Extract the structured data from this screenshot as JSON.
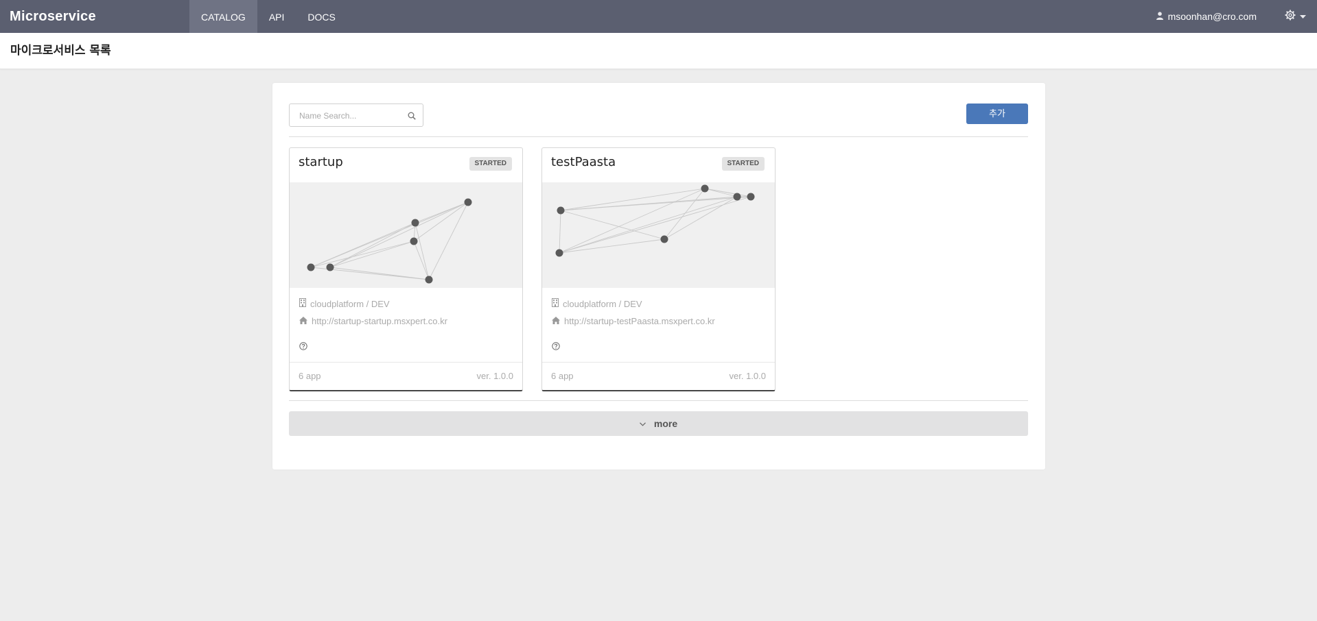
{
  "topbar": {
    "brand": "Microservice",
    "nav": [
      "CATALOG",
      "API",
      "DOCS"
    ],
    "active_nav": "CATALOG",
    "user": "msoonhan@cro.com",
    "user_icon": "user-icon",
    "settings_icon": "gear-icon"
  },
  "page": {
    "title": "마이크로서비스 목록"
  },
  "toolbar": {
    "search_placeholder": "Name Search...",
    "add_label": "추가"
  },
  "services": [
    {
      "name": "startup",
      "status": "STARTED",
      "org": "cloudplatform / DEV",
      "url": "http://startup-startup.msxpert.co.kr",
      "apps": "6 app",
      "version": "ver. 1.0.0"
    },
    {
      "name": "testPaasta",
      "status": "STARTED",
      "org": "cloudplatform / DEV",
      "url": "http://startup-testPaasta.msxpert.co.kr",
      "apps": "6 app",
      "version": "ver. 1.0.0"
    }
  ],
  "more_label": "more",
  "colors": {
    "topbar": "#5b5f70",
    "accent": "#4a78b9",
    "node": "#5a5a5a"
  }
}
